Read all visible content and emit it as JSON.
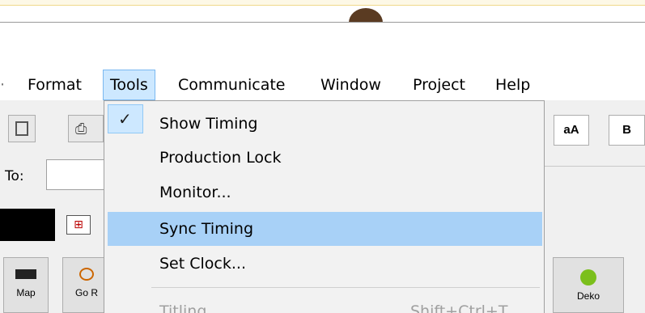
{
  "menubar": {
    "items": [
      {
        "label": "Format"
      },
      {
        "label": "Tools"
      },
      {
        "label": "Communicate"
      },
      {
        "label": "Window"
      },
      {
        "label": "Project"
      },
      {
        "label": "Help"
      }
    ]
  },
  "toolbar": {
    "to_label": "To:",
    "aa_label": "aA",
    "b_label": "B"
  },
  "buttons": {
    "map_label": "Map",
    "go_label": "Go R",
    "deko_label": "Deko"
  },
  "tools_menu": {
    "items": [
      {
        "label": "Show Timing",
        "checked": true
      },
      {
        "label": "Production Lock"
      },
      {
        "label": "Monitor..."
      },
      {
        "label": "Sync Timing",
        "highlighted": true
      },
      {
        "label": "Set Clock..."
      },
      {
        "label": "Titling...",
        "shortcut": "Shift+Ctrl+T",
        "disabled": true
      }
    ]
  },
  "colors": {
    "highlight": "#a8d1f7",
    "checked_bg": "#cde8ff",
    "disabled_text": "#a0a0a0"
  }
}
